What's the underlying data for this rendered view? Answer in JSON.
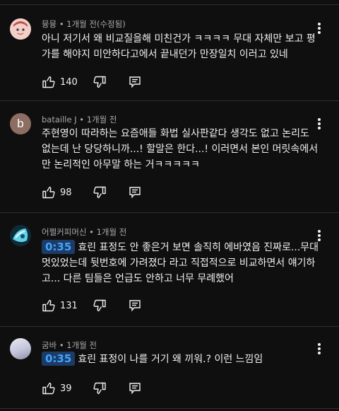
{
  "comments": [
    {
      "author": "뮹뮹",
      "sep": "•",
      "time": "1개월 전(수정됨)",
      "text": "아니 저기서 왜 비교질을해 미친건가 ㅋㅋㅋㅋ 무대 자체만 보고 평가를 해야지 미안하다고에서 끝내던가 만장일치 이러고 있네",
      "likes": "140",
      "avatar_color": "#d9a0a8"
    },
    {
      "author": "bataille J",
      "sep": "•",
      "time": "1개월 전",
      "avatar_letter": "b",
      "avatar_color": "#8d6e63",
      "text": "주현영이 따라하는 요즘애들 화법 실사판같다 생각도 없고 논리도 없는데 난 당당하니까...! 할말은 한다...! 이러면서 본인 머릿속에서만 논리적인 아무말 하는 거ㅋㅋㅋㅋㅋ",
      "likes": "98"
    },
    {
      "author": "어쩔커피머신",
      "sep": "•",
      "time": "1개월 전",
      "timestamp": "0:35",
      "text": "효린 표정도 안 좋은거 보면 솔직히 에바였음 진짜로...무대 멋있었는데 뒷번호에 가려졌다 라고 직접적으로 비교하면서 얘기하고... 다른 팀들은 언급도 안하고 너무 무례했어",
      "likes": "131",
      "avatar_color": "#5fd3e8"
    },
    {
      "author": "굼바",
      "sep": "•",
      "time": "1개월 전",
      "timestamp": "0:35",
      "text": "효린 표정이 나를 거기 왜 끼워.? 이런 느낌임",
      "likes": "39",
      "avatar_color": "#c9cbe0"
    }
  ],
  "icons": {
    "like": "thumb-up-icon",
    "dislike": "thumb-down-icon",
    "reply": "reply-icon",
    "more": "more-vert-icon"
  },
  "colors": {
    "background": "#0f0f0f",
    "text": "#f1f1f1",
    "meta": "#aaaaaa",
    "timestamp_link": "#3ea6ff",
    "timestamp_bg": "#1e3b66"
  }
}
